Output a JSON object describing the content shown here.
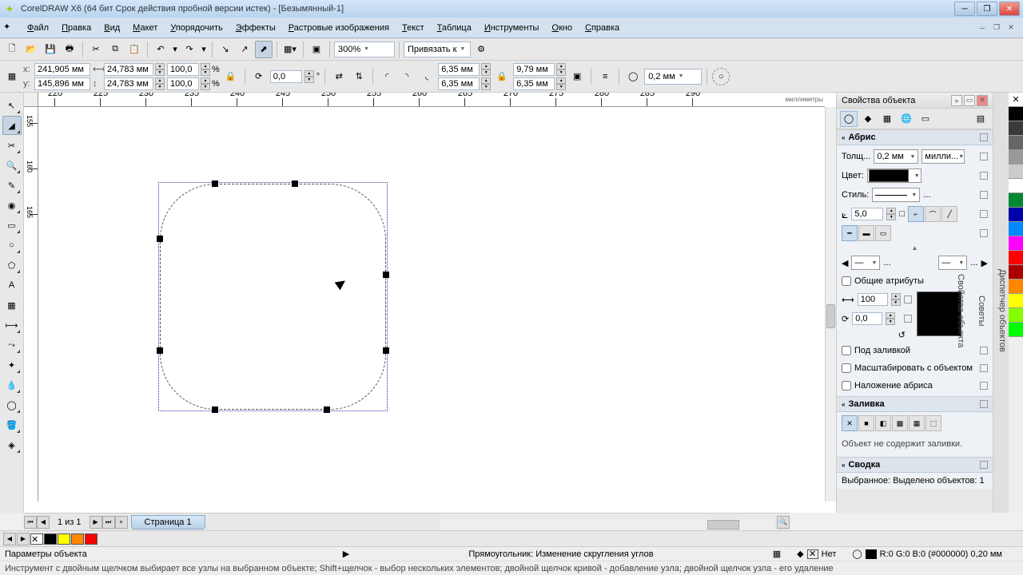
{
  "title": "CorelDRAW X6 (64 бит Срок действия пробной версии истек) - [Безымянный-1]",
  "menu": [
    "Файл",
    "Правка",
    "Вид",
    "Макет",
    "Упорядочить",
    "Эффекты",
    "Растровые изображения",
    "Текст",
    "Таблица",
    "Инструменты",
    "Окно",
    "Справка"
  ],
  "toolbar": {
    "zoom": "300%",
    "snap_label": "Привязать к"
  },
  "prop": {
    "x": "241,905 мм",
    "y": "145,896 мм",
    "w": "24,783 мм",
    "h": "24,783 мм",
    "sx": "100,0",
    "sy": "100,0",
    "pct": "%",
    "rotation": "0,0",
    "rotation_unit": "°",
    "corner_w": "6,35 мм",
    "corner_h": "6,35 мм",
    "r2_w": "9,79 мм",
    "r2_h": "6,35 мм",
    "outline_width": "0,2 мм"
  },
  "ruler": {
    "units": "миллиметры",
    "h_ticks": [
      "220",
      "225",
      "230",
      "235",
      "240",
      "245",
      "250",
      "255",
      "260",
      "265",
      "270",
      "275",
      "280",
      "285",
      "290"
    ],
    "v_ticks": [
      "155",
      "160",
      "165",
      "",
      "",
      ""
    ]
  },
  "right_panel": {
    "title": "Свойства объекта",
    "section_outline": "Абрис",
    "width_label": "Толщ...",
    "width_value": "0,2 мм",
    "units_value": "милли...",
    "color_label": "Цвет:",
    "style_label": "Стиль:",
    "style_more": "...",
    "miter_value": "5,0",
    "arrow_more": "...",
    "share_attrs": "Общие атрибуты",
    "stretch_value": "100",
    "nib_angle": "0,0",
    "behind_fill": "Под заливкой",
    "scale_with": "Масштабировать с объектом",
    "overprint": "Наложение абриса",
    "section_fill": "Заливка",
    "no_fill_msg": "Объект не содержит заливки.",
    "section_summary": "Сводка",
    "selection_info": "Выбранное: Выделено объектов: 1"
  },
  "docker_tabs": [
    "Диспетчер объектов",
    "Советы",
    "Свойства объекта"
  ],
  "page_nav": {
    "page_of": "1 из 1",
    "page_tab": "Страница 1"
  },
  "status": {
    "left": "Параметры объекта",
    "center": "Прямоугольник: Изменение скругления углов",
    "fill_none": "Нет",
    "outline_info": "R:0 G:0 B:0 (#000000) 0,20 мм"
  },
  "hint": "Инструмент с двойным щелчком выбирает все узлы на выбранном объекте; Shift+щелчок - выбор нескольких элементов; двойной щелчок кривой - добавление узла; двойной щелчок узла - его удаление",
  "colors": [
    "#000",
    "#3a3a3a",
    "#666",
    "#999",
    "#ccc",
    "#fff",
    "#083",
    "#00a",
    "#08f",
    "#f0f",
    "#f00",
    "#a00",
    "#f80",
    "#ff0",
    "#8f0",
    "#0f0"
  ]
}
